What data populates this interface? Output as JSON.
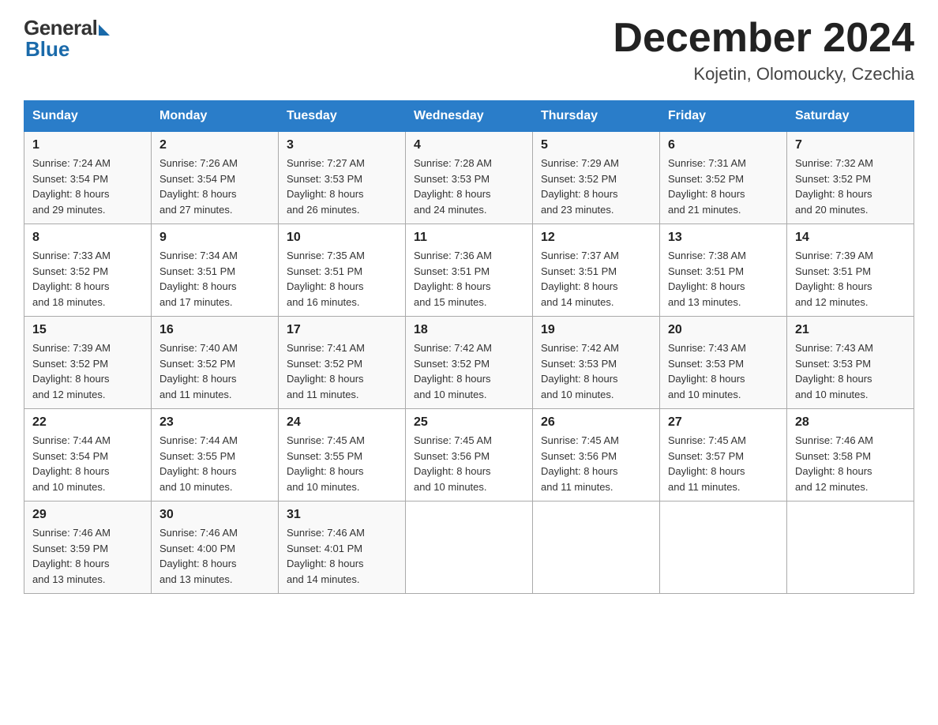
{
  "header": {
    "logo_general": "General",
    "logo_blue": "Blue",
    "title": "December 2024",
    "location": "Kojetin, Olomoucky, Czechia"
  },
  "weekdays": [
    "Sunday",
    "Monday",
    "Tuesday",
    "Wednesday",
    "Thursday",
    "Friday",
    "Saturday"
  ],
  "weeks": [
    [
      {
        "day": "1",
        "sunrise": "7:24 AM",
        "sunset": "3:54 PM",
        "daylight": "8 hours and 29 minutes."
      },
      {
        "day": "2",
        "sunrise": "7:26 AM",
        "sunset": "3:54 PM",
        "daylight": "8 hours and 27 minutes."
      },
      {
        "day": "3",
        "sunrise": "7:27 AM",
        "sunset": "3:53 PM",
        "daylight": "8 hours and 26 minutes."
      },
      {
        "day": "4",
        "sunrise": "7:28 AM",
        "sunset": "3:53 PM",
        "daylight": "8 hours and 24 minutes."
      },
      {
        "day": "5",
        "sunrise": "7:29 AM",
        "sunset": "3:52 PM",
        "daylight": "8 hours and 23 minutes."
      },
      {
        "day": "6",
        "sunrise": "7:31 AM",
        "sunset": "3:52 PM",
        "daylight": "8 hours and 21 minutes."
      },
      {
        "day": "7",
        "sunrise": "7:32 AM",
        "sunset": "3:52 PM",
        "daylight": "8 hours and 20 minutes."
      }
    ],
    [
      {
        "day": "8",
        "sunrise": "7:33 AM",
        "sunset": "3:52 PM",
        "daylight": "8 hours and 18 minutes."
      },
      {
        "day": "9",
        "sunrise": "7:34 AM",
        "sunset": "3:51 PM",
        "daylight": "8 hours and 17 minutes."
      },
      {
        "day": "10",
        "sunrise": "7:35 AM",
        "sunset": "3:51 PM",
        "daylight": "8 hours and 16 minutes."
      },
      {
        "day": "11",
        "sunrise": "7:36 AM",
        "sunset": "3:51 PM",
        "daylight": "8 hours and 15 minutes."
      },
      {
        "day": "12",
        "sunrise": "7:37 AM",
        "sunset": "3:51 PM",
        "daylight": "8 hours and 14 minutes."
      },
      {
        "day": "13",
        "sunrise": "7:38 AM",
        "sunset": "3:51 PM",
        "daylight": "8 hours and 13 minutes."
      },
      {
        "day": "14",
        "sunrise": "7:39 AM",
        "sunset": "3:51 PM",
        "daylight": "8 hours and 12 minutes."
      }
    ],
    [
      {
        "day": "15",
        "sunrise": "7:39 AM",
        "sunset": "3:52 PM",
        "daylight": "8 hours and 12 minutes."
      },
      {
        "day": "16",
        "sunrise": "7:40 AM",
        "sunset": "3:52 PM",
        "daylight": "8 hours and 11 minutes."
      },
      {
        "day": "17",
        "sunrise": "7:41 AM",
        "sunset": "3:52 PM",
        "daylight": "8 hours and 11 minutes."
      },
      {
        "day": "18",
        "sunrise": "7:42 AM",
        "sunset": "3:52 PM",
        "daylight": "8 hours and 10 minutes."
      },
      {
        "day": "19",
        "sunrise": "7:42 AM",
        "sunset": "3:53 PM",
        "daylight": "8 hours and 10 minutes."
      },
      {
        "day": "20",
        "sunrise": "7:43 AM",
        "sunset": "3:53 PM",
        "daylight": "8 hours and 10 minutes."
      },
      {
        "day": "21",
        "sunrise": "7:43 AM",
        "sunset": "3:53 PM",
        "daylight": "8 hours and 10 minutes."
      }
    ],
    [
      {
        "day": "22",
        "sunrise": "7:44 AM",
        "sunset": "3:54 PM",
        "daylight": "8 hours and 10 minutes."
      },
      {
        "day": "23",
        "sunrise": "7:44 AM",
        "sunset": "3:55 PM",
        "daylight": "8 hours and 10 minutes."
      },
      {
        "day": "24",
        "sunrise": "7:45 AM",
        "sunset": "3:55 PM",
        "daylight": "8 hours and 10 minutes."
      },
      {
        "day": "25",
        "sunrise": "7:45 AM",
        "sunset": "3:56 PM",
        "daylight": "8 hours and 10 minutes."
      },
      {
        "day": "26",
        "sunrise": "7:45 AM",
        "sunset": "3:56 PM",
        "daylight": "8 hours and 11 minutes."
      },
      {
        "day": "27",
        "sunrise": "7:45 AM",
        "sunset": "3:57 PM",
        "daylight": "8 hours and 11 minutes."
      },
      {
        "day": "28",
        "sunrise": "7:46 AM",
        "sunset": "3:58 PM",
        "daylight": "8 hours and 12 minutes."
      }
    ],
    [
      {
        "day": "29",
        "sunrise": "7:46 AM",
        "sunset": "3:59 PM",
        "daylight": "8 hours and 13 minutes."
      },
      {
        "day": "30",
        "sunrise": "7:46 AM",
        "sunset": "4:00 PM",
        "daylight": "8 hours and 13 minutes."
      },
      {
        "day": "31",
        "sunrise": "7:46 AM",
        "sunset": "4:01 PM",
        "daylight": "8 hours and 14 minutes."
      },
      null,
      null,
      null,
      null
    ]
  ],
  "labels": {
    "sunrise": "Sunrise: ",
    "sunset": "Sunset: ",
    "daylight": "Daylight: "
  }
}
